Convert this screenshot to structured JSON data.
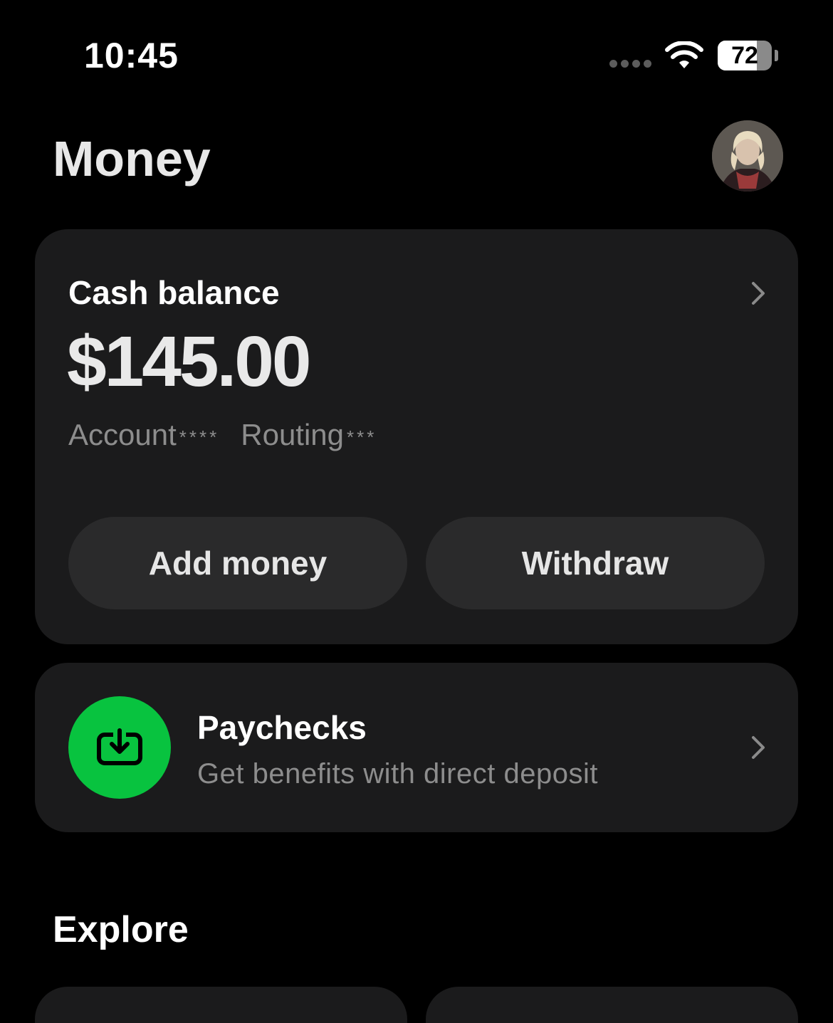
{
  "status_bar": {
    "time": "10:45",
    "battery_level": 72,
    "battery_label": "72"
  },
  "header": {
    "title": "Money"
  },
  "balance_card": {
    "label": "Cash balance",
    "amount": "$145.00",
    "account_label": "Account",
    "account_mask": "****",
    "routing_label": "Routing",
    "routing_mask": "***",
    "add_money_label": "Add money",
    "withdraw_label": "Withdraw"
  },
  "paychecks": {
    "title": "Paychecks",
    "subtitle": "Get benefits with direct deposit",
    "icon": "deposit-tray-icon",
    "accent_color": "#08c33f"
  },
  "explore": {
    "title": "Explore"
  }
}
